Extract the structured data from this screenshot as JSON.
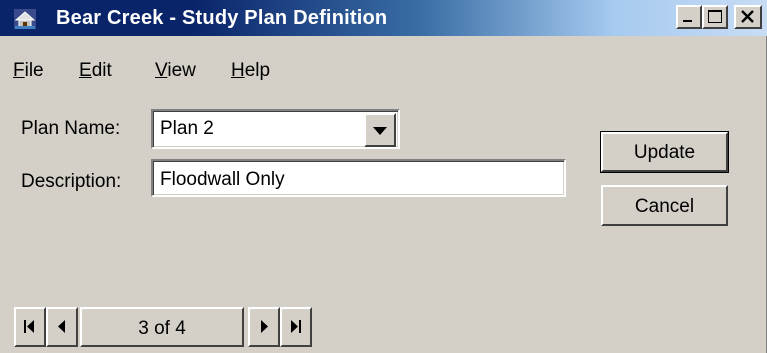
{
  "window": {
    "title": "Bear Creek - Study Plan Definition",
    "controls": [
      "minimize-icon",
      "maximize-icon",
      "close-icon"
    ],
    "accent_color": "#0a246a",
    "face_color": "#d4d0c8"
  },
  "menu": {
    "items": [
      {
        "accel": "F",
        "rest": "ile"
      },
      {
        "accel": "E",
        "rest": "dit"
      },
      {
        "accel": "V",
        "rest": "iew"
      },
      {
        "accel": "H",
        "rest": "elp"
      }
    ]
  },
  "form": {
    "plan_name_label": "Plan Name:",
    "plan_name_value": "Plan 2",
    "description_label": "Description:",
    "description_value": "Floodwall Only"
  },
  "buttons": {
    "update": "Update",
    "cancel": "Cancel"
  },
  "navigator": {
    "record_text": "3 of 4",
    "icons": [
      "first-record-icon",
      "previous-record-icon",
      "next-record-icon",
      "last-record-icon"
    ]
  }
}
